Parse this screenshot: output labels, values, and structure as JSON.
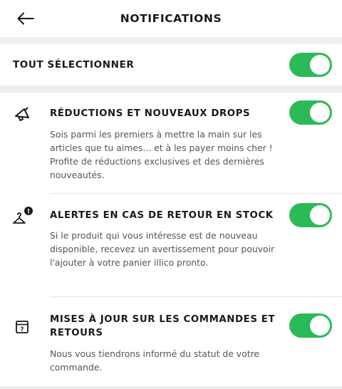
{
  "header": {
    "title": "NOTIFICATIONS",
    "back_icon": "arrow-left-icon"
  },
  "select_all": {
    "label": "TOUT SÉLECTIONNER",
    "enabled": true
  },
  "options": [
    {
      "icon": "megaphone-icon",
      "title": "RÉDUCTIONS ET NOUVEAUX DROPS",
      "description": "Sois parmi les premiers à mettre la main sur les articles que tu aimes... et à les payer moins cher ! Profite de réductions exclusives et des dernières nouveautés.",
      "enabled": true
    },
    {
      "icon": "hanger-alert-icon",
      "title": "ALERTES EN CAS DE RETOUR EN STOCK",
      "description": "Si le produit qui vous intéresse est de nouveau disponible, recevez un avertissement pour pouvoir l'ajouter à votre panier illico pronto.",
      "enabled": true
    },
    {
      "icon": "package-question-icon",
      "title": "MISES À JOUR SUR LES COMMANDES ET RETOURS",
      "description": "Nous vous tiendrons informé du statut de votre commande.",
      "enabled": true
    }
  ],
  "colors": {
    "toggle_on": "#2aba57",
    "background": "#ffffff",
    "divider": "#efefef",
    "text": "#1a1a1a",
    "muted_text": "#555555"
  }
}
